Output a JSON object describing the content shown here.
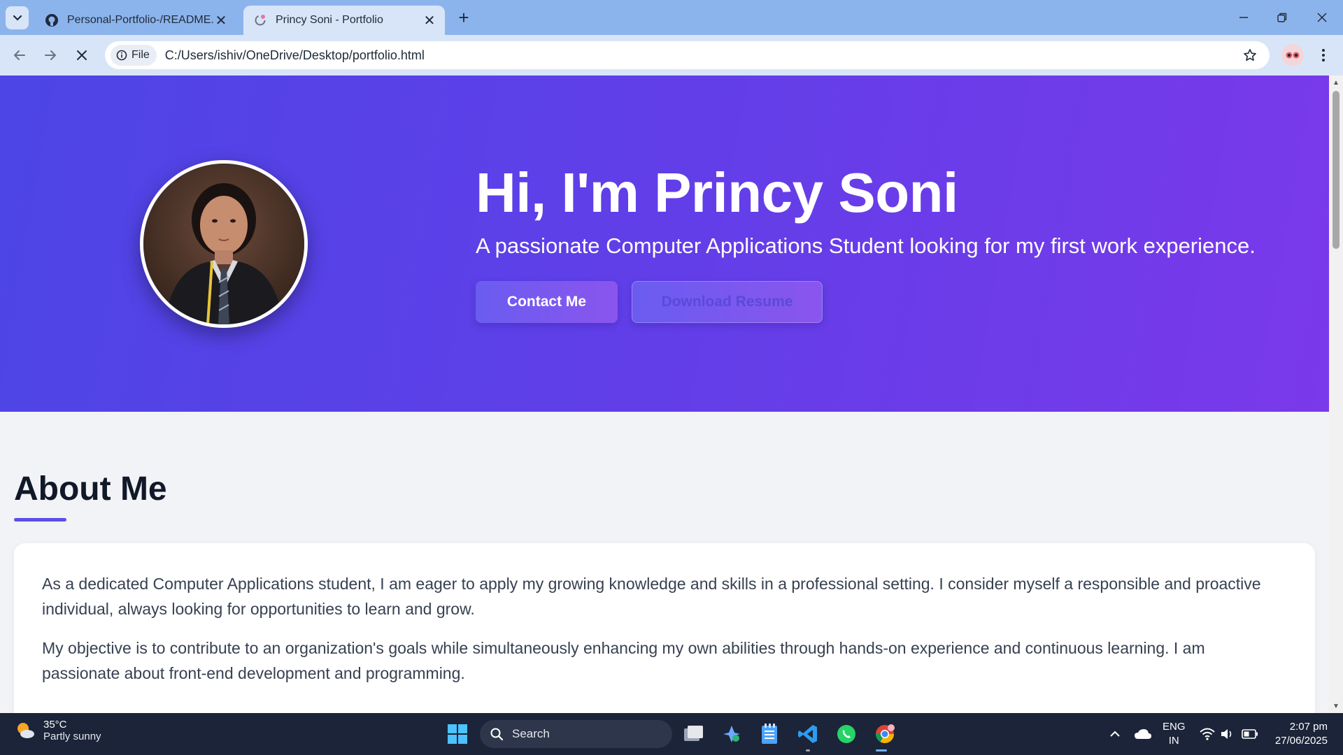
{
  "browser": {
    "tabs": [
      {
        "title": "Personal-Portfolio-/README.md",
        "favicon": "github-icon",
        "active": false
      },
      {
        "title": "Princy Soni - Portfolio",
        "favicon": "loading-globe-icon",
        "active": true
      }
    ],
    "address": {
      "chip_label": "File",
      "url": "C:/Users/ishiv/OneDrive/Desktop/portfolio.html"
    }
  },
  "hero": {
    "title": "Hi, I'm Princy Soni",
    "subtitle": "A passionate Computer Applications Student looking for my first work experience.",
    "contact_button": "Contact Me",
    "resume_button": "Download Resume"
  },
  "about": {
    "heading": "About Me",
    "paragraphs": [
      "As a dedicated Computer Applications student, I am eager to apply my growing knowledge and skills in a professional setting. I consider myself a responsible and proactive individual, always looking for opportunities to learn and grow.",
      "My objective is to contribute to an organization's goals while simultaneously enhancing my own abilities through hands-on experience and continuous learning. I am passionate about front-end development and programming."
    ]
  },
  "taskbar": {
    "weather": {
      "temp": "35°C",
      "condition": "Partly sunny"
    },
    "search_label": "Search",
    "language": {
      "line1": "ENG",
      "line2": "IN"
    },
    "clock": {
      "time": "2:07 pm",
      "date": "27/06/2025"
    }
  },
  "colors": {
    "hero_gradient_start": "#4d45e6",
    "hero_gradient_end": "#7a39ea",
    "accent": "#5b4ee8",
    "taskbar": "#1b2438",
    "tabstrip": "#8cb4ec"
  }
}
